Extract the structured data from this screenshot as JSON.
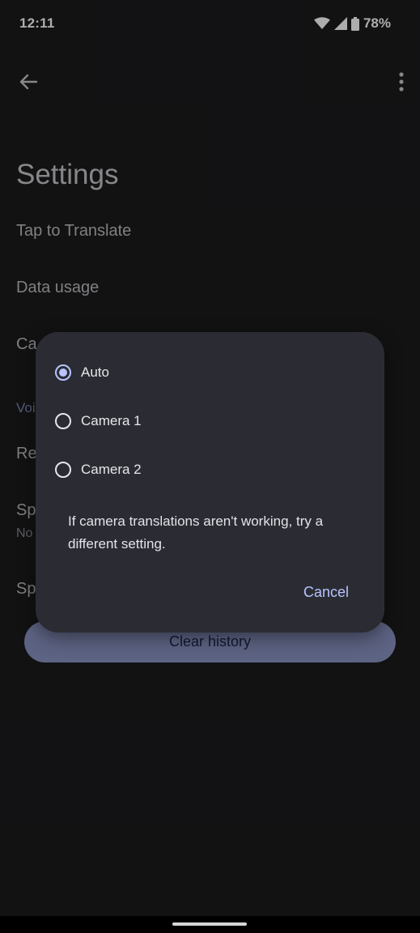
{
  "status_bar": {
    "time": "12:11",
    "battery": "78%"
  },
  "app_bar": {
    "back_icon": "arrow-left-icon",
    "more_icon": "more-vert-icon"
  },
  "settings": {
    "title": "Settings",
    "rows": [
      {
        "label": "Tap to Translate"
      },
      {
        "label": "Data usage"
      },
      {
        "label": "Ca"
      },
      {
        "label": "Voi"
      },
      {
        "label": "Re"
      },
      {
        "label": "Sp"
      },
      {
        "label": "No"
      },
      {
        "label": "Sp"
      }
    ],
    "clear_history_label": "Clear history"
  },
  "dialog": {
    "options": [
      {
        "label": "Auto",
        "selected": true
      },
      {
        "label": "Camera 1",
        "selected": false
      },
      {
        "label": "Camera 2",
        "selected": false
      }
    ],
    "message": "If camera translations aren't working, try a different setting.",
    "cancel_label": "Cancel"
  },
  "colors": {
    "accent": "#b8c3ff",
    "background": "#1b1b1d",
    "dialog": "#2b2c33"
  }
}
